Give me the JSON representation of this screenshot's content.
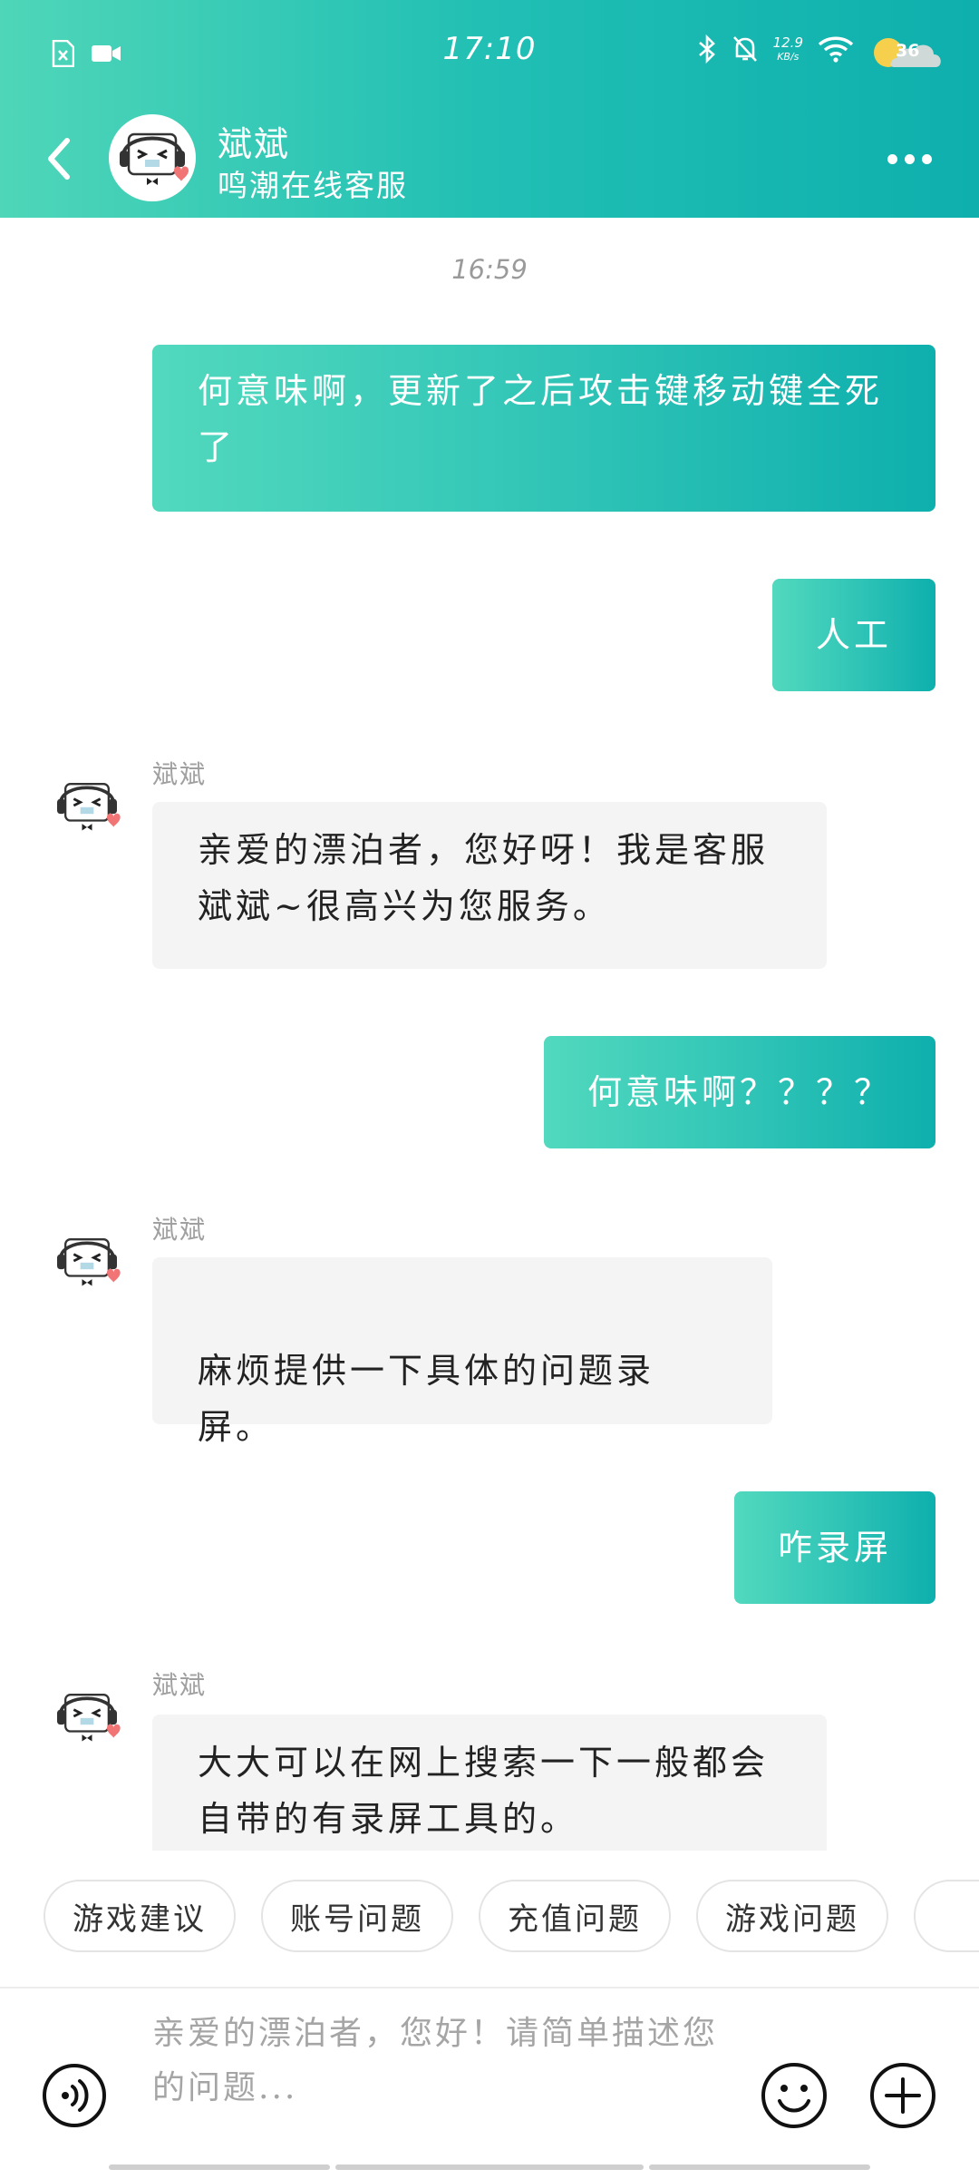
{
  "status_bar": {
    "time": "17:10",
    "net_speed_value": "12.9",
    "net_speed_unit": "KB/s",
    "weather_temp": "36"
  },
  "header": {
    "agent_name": "斌斌",
    "agent_subtitle": "鸣潮在线客服"
  },
  "chat": {
    "time_separator": "16:59",
    "messages": [
      {
        "from": "user",
        "text": "何意味啊，更新了之后攻击键移动键全死了"
      },
      {
        "from": "user",
        "text": "人工"
      },
      {
        "from": "agent",
        "sender": "斌斌",
        "text": "亲爱的漂泊者，您好呀！我是客服斌斌~很高兴为您服务。"
      },
      {
        "from": "user",
        "text": "何意味啊？？？？"
      },
      {
        "from": "agent",
        "sender": "斌斌",
        "text": "麻烦提供一下具体的问题录屏。"
      },
      {
        "from": "user",
        "text": "咋录屏"
      },
      {
        "from": "agent",
        "sender": "斌斌",
        "text": "大大可以在网上搜索一下一般都会自带的有录屏工具的。"
      }
    ]
  },
  "quick_replies": [
    "游戏建议",
    "账号问题",
    "充值问题",
    "游戏问题",
    ""
  ],
  "input": {
    "placeholder": "亲爱的漂泊者，您好！请简单描述您的问题...",
    "value": ""
  },
  "icons": {
    "back": "chevron-left-icon",
    "more": "more-dots-icon",
    "voice": "voice-icon",
    "emoji": "emoji-icon",
    "plus": "plus-icon"
  },
  "colors": {
    "header_start": "#4fd6b8",
    "header_end": "#0eafad",
    "agent_bubble": "#f4f4f4"
  }
}
